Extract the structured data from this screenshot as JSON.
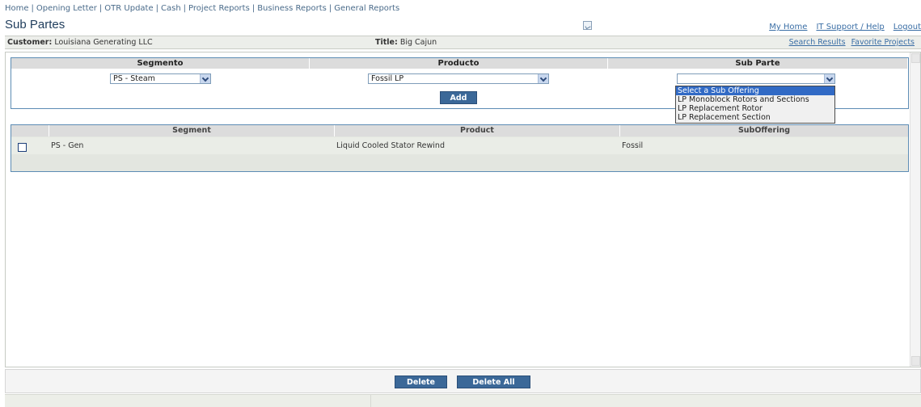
{
  "nav": [
    "Home",
    "Opening Letter",
    "OTR Update",
    "Cash",
    "Project Reports",
    "Business Reports",
    "General Reports"
  ],
  "page_title": "Sub Partes",
  "top_links": [
    "My Home",
    "IT Support / Help",
    "Logout"
  ],
  "info": {
    "customer_label": "Customer:",
    "customer_value": "Louisiana Generating LLC",
    "title_label": "Title:",
    "title_value": "Big Cajun",
    "links": [
      "Search Results",
      "Favorite Projects"
    ]
  },
  "add_form": {
    "headers": [
      "Segmento",
      "Producto",
      "Sub Parte"
    ],
    "segmento_value": "PS - Steam",
    "producto_value": "Fossil LP",
    "subparte_value": "",
    "add_label": "Add",
    "subparte_options": [
      "Select a Sub Offering",
      "LP Monoblock Rotors and Sections",
      "LP Replacement Rotor",
      "LP Replacement Section"
    ]
  },
  "list": {
    "headers": [
      "Segment",
      "Product",
      "SubOffering"
    ],
    "rows": [
      {
        "segment": "PS - Gen",
        "product": "Liquid Cooled Stator Rewind",
        "suboffering": "Fossil"
      }
    ]
  },
  "footer": {
    "delete_label": "Delete",
    "delete_all_label": "Delete All"
  }
}
